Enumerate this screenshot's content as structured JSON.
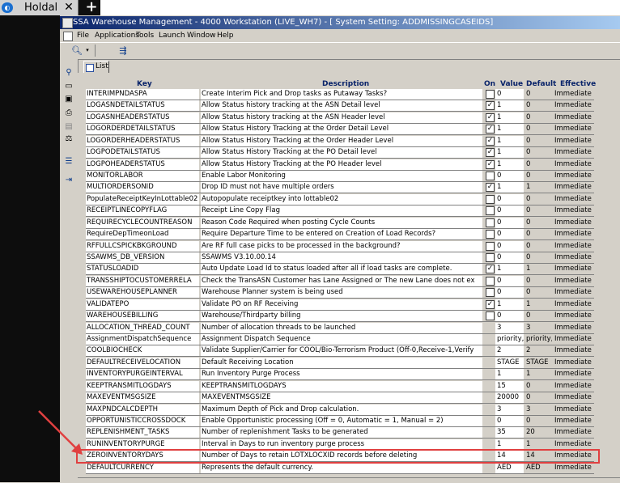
{
  "tab": {
    "title": "Holdal",
    "close": "✕",
    "new": "+"
  },
  "window": {
    "title": "SSA Warehouse Management - 4000 Workstation (LIVE_WH7) - [ System Setting: ADDMISSINGCASEIDS]"
  },
  "menu": [
    "File",
    "Applications",
    "Tools",
    "Launch",
    "Window",
    "Help"
  ],
  "toolbar_icons": [
    "search-dropdown-icon",
    "filter-icon"
  ],
  "vtoolbar_icons": [
    "search-icon",
    "folder-icon",
    "save-icon",
    "print-icon",
    "document-icon",
    "scale-icon",
    "list-icon",
    "exit-icon"
  ],
  "list_tab": {
    "label": "List"
  },
  "columns": {
    "key": "Key",
    "description": "Description",
    "on": "On",
    "value": "Value",
    "default": "Default",
    "effective": "Effective"
  },
  "rows": [
    {
      "key": "INTERIMPNDASPA",
      "desc": "Create Interim Pick and Drop tasks as Putaway Tasks?",
      "on": false,
      "value": "0",
      "default": "0",
      "eff": "Immediate"
    },
    {
      "key": "LOGASNDETAILSTATUS",
      "desc": "Allow Status history tracking at the ASN Detail level",
      "on": true,
      "value": "1",
      "default": "0",
      "eff": "Immediate"
    },
    {
      "key": "LOGASNHEADERSTATUS",
      "desc": "Allow Status history tracking at the ASN Header level",
      "on": true,
      "value": "1",
      "default": "0",
      "eff": "Immediate"
    },
    {
      "key": "LOGORDERDETAILSTATUS",
      "desc": "Allow Status History Tracking at the Order Detail Level",
      "on": true,
      "value": "1",
      "default": "0",
      "eff": "Immediate"
    },
    {
      "key": "LOGORDERHEADERSTATUS",
      "desc": "Allow Status History Tracking at the Order Header Level",
      "on": true,
      "value": "1",
      "default": "0",
      "eff": "Immediate"
    },
    {
      "key": "LOGPODETAILSTATUS",
      "desc": "Allow Status History Tracking at the PO Detail level",
      "on": true,
      "value": "1",
      "default": "0",
      "eff": "Immediate"
    },
    {
      "key": "LOGPOHEADERSTATUS",
      "desc": "Allow Status History Tracking at the PO Header level",
      "on": true,
      "value": "1",
      "default": "0",
      "eff": "Immediate"
    },
    {
      "key": "MONITORLABOR",
      "desc": "Enable Labor Monitoring",
      "on": false,
      "value": "0",
      "default": "0",
      "eff": "Immediate"
    },
    {
      "key": "MULTIORDERSONID",
      "desc": "Drop ID must not have multiple orders",
      "on": true,
      "value": "1",
      "default": "1",
      "eff": "Immediate"
    },
    {
      "key": "PopulateReceiptKeyInLottable02",
      "desc": "Autopopulate receiptkey into lottable02",
      "on": false,
      "value": "0",
      "default": "0",
      "eff": "Immediate"
    },
    {
      "key": "RECEIPTLINECOPYFLAG",
      "desc": "Receipt Line Copy Flag",
      "on": false,
      "value": "0",
      "default": "0",
      "eff": "Immediate"
    },
    {
      "key": "REQUIRECYCLECOUNTREASON",
      "desc": "Reason Code Required when posting Cycle Counts",
      "on": false,
      "value": "0",
      "default": "0",
      "eff": "Immediate"
    },
    {
      "key": "RequireDepTimeonLoad",
      "desc": "Require Departure Time to be entered on Creation of Load Records?",
      "on": false,
      "value": "0",
      "default": "0",
      "eff": "Immediate"
    },
    {
      "key": "RFFULLCSPICKBKGROUND",
      "desc": "Are RF full case picks to be processed in the background?",
      "on": false,
      "value": "0",
      "default": "0",
      "eff": "Immediate"
    },
    {
      "key": "SSAWMS_DB_VERSION",
      "desc": "SSAWMS V3.10.00.14",
      "on": false,
      "value": "0",
      "default": "0",
      "eff": "Immediate"
    },
    {
      "key": "STATUSLOADID",
      "desc": "Auto Update Load Id to status loaded after all if load tasks are complete.",
      "on": true,
      "value": "1",
      "default": "1",
      "eff": "Immediate"
    },
    {
      "key": "TRANSSHIPTOCUSTOMERRELA",
      "desc": "Check the TransASN Customer has Lane Assigned or The new Lane does not ex",
      "on": false,
      "value": "0",
      "default": "0",
      "eff": "Immediate"
    },
    {
      "key": "USEWAREHOUSEPLANNER",
      "desc": "Warehouse Planner system is being used",
      "on": false,
      "value": "0",
      "default": "0",
      "eff": "Immediate"
    },
    {
      "key": "VALIDATEPO",
      "desc": "Validate PO on RF Receiving",
      "on": true,
      "value": "1",
      "default": "1",
      "eff": "Immediate"
    },
    {
      "key": "WAREHOUSEBILLING",
      "desc": "Warehouse/Thirdparty billing",
      "on": false,
      "value": "0",
      "default": "0",
      "eff": "Immediate"
    },
    {
      "key": "ALLOCATION_THREAD_COUNT",
      "desc": "Number of allocation threads to be launched",
      "on": null,
      "value": "3",
      "default": "3",
      "eff": "Immediate"
    },
    {
      "key": "AssignmentDispatchSequence",
      "desc": "Assignment Dispatch Sequence",
      "on": null,
      "value": "priority, l",
      "default": "priority, l",
      "eff": "Immediate"
    },
    {
      "key": "COOLBIOCHECK",
      "desc": "Validate Supplier/Carrier for COOL/Bio-Terrorism Product (Off-0,Receive-1,Verify",
      "on": null,
      "value": "2",
      "default": "2",
      "eff": "Immediate"
    },
    {
      "key": "DEFAULTRECEIVELOCATION",
      "desc": "Default Receiving Location",
      "on": null,
      "value": "STAGE",
      "default": "STAGE",
      "eff": "Immediate"
    },
    {
      "key": "INVENTORYPURGEINTERVAL",
      "desc": "Run Inventory Purge Process",
      "on": null,
      "value": "1",
      "default": "1",
      "eff": "Immediate"
    },
    {
      "key": "KEEPTRANSMITLOGDAYS",
      "desc": "KEEPTRANSMITLOGDAYS",
      "on": null,
      "value": "15",
      "default": "0",
      "eff": "Immediate"
    },
    {
      "key": "MAXEVENTMSGSIZE",
      "desc": "MAXEVENTMSGSIZE",
      "on": null,
      "value": "20000",
      "default": "0",
      "eff": "Immediate"
    },
    {
      "key": "MAXPNDCALCDEPTH",
      "desc": "Maximum Depth of Pick and Drop calculation.",
      "on": null,
      "value": "3",
      "default": "3",
      "eff": "Immediate"
    },
    {
      "key": "OPPORTUNISTICCROSSDOCK",
      "desc": "Enable Opportunistic processing (Off = 0, Automatic = 1, Manual = 2)",
      "on": null,
      "value": "0",
      "default": "0",
      "eff": "Immediate"
    },
    {
      "key": "REPLENISHMENT_TASKS",
      "desc": "Number of replenishment Tasks to be generated",
      "on": null,
      "value": "35",
      "default": "20",
      "eff": "Immediate"
    },
    {
      "key": "RUNINVENTORYPURGE",
      "desc": "Interval in Days to run inventory purge process",
      "on": null,
      "value": "1",
      "default": "1",
      "eff": "Immediate"
    },
    {
      "key": "ZEROINVENTORYDAYS",
      "desc": "Number of Days to retain LOTXLOCXID records before deleting",
      "on": null,
      "value": "14",
      "default": "14",
      "eff": "Immediate"
    },
    {
      "key": "DEFAULTCURRENCY",
      "desc": "Represents the default currency.",
      "on": null,
      "value": "AED",
      "default": "AED",
      "eff": "Immediate"
    }
  ],
  "colors": {
    "highlight": "#e04040",
    "header_text": "#0a246a",
    "title_bar": "#0a246a"
  }
}
